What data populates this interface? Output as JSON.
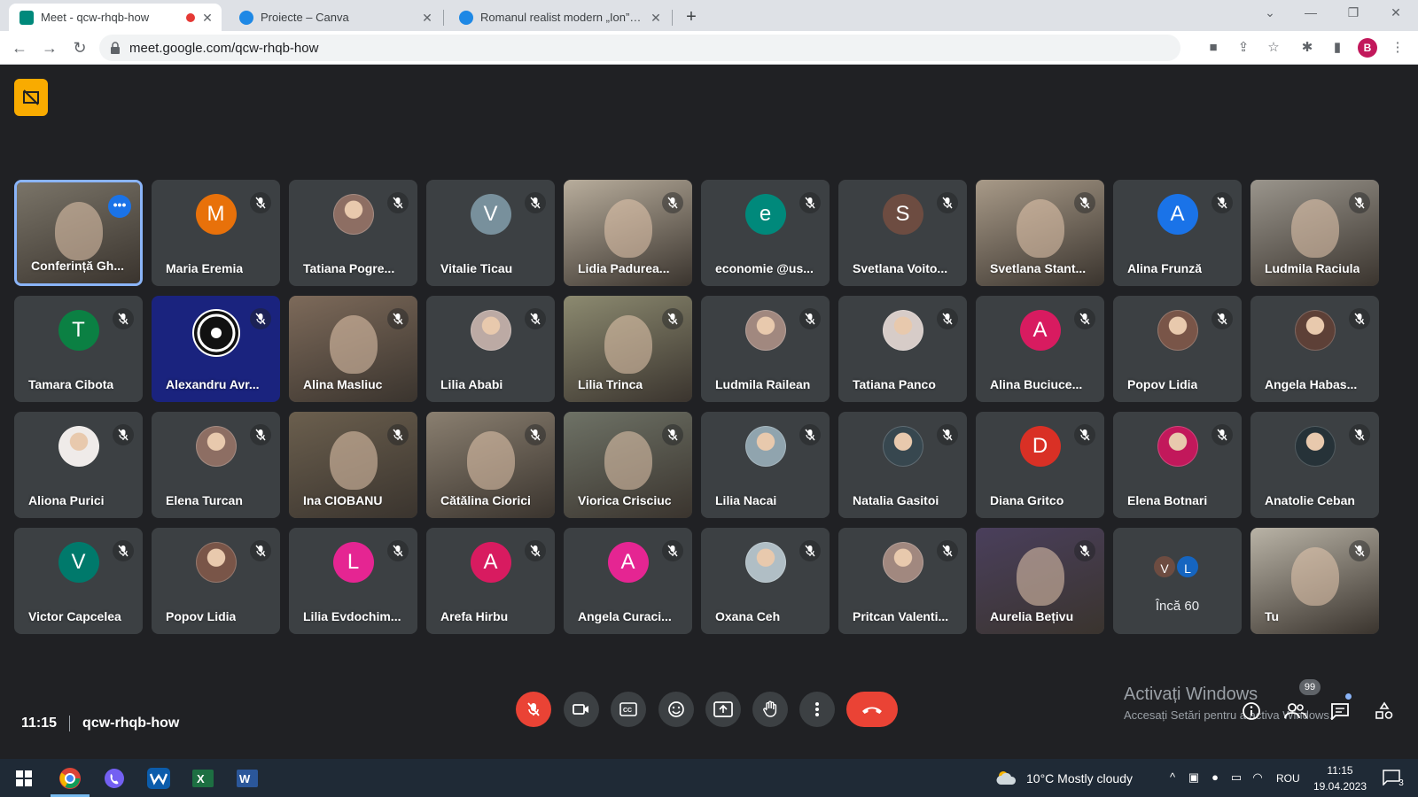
{
  "browser": {
    "tabs": [
      {
        "title": "Meet - qcw-rhqb-how",
        "favicon_color": "#00897b",
        "recording": true,
        "active": true
      },
      {
        "title": "Proiecte – Canva",
        "favicon_color": "#1e88e5",
        "recording": false,
        "active": false
      },
      {
        "title": "Romanul realist modern „Ion” de",
        "favicon_color": "#1e88e5",
        "recording": false,
        "active": false
      }
    ],
    "url": "meet.google.com/qcw-rhqb-how",
    "profile_initial": "B"
  },
  "meeting": {
    "time": "11:15",
    "code": "qcw-rhqb-how",
    "overflow": {
      "label": "Încă 60",
      "initials": [
        "V",
        "L"
      ],
      "colors": [
        "#6d4c41",
        "#1565c0"
      ]
    },
    "people_badge": "99"
  },
  "participants": [
    {
      "name": "Conferință Gh...",
      "kind": "video",
      "bg": "#7a7468",
      "selected": true
    },
    {
      "name": "Maria Eremia",
      "kind": "initial",
      "initial": "M",
      "color": "#e8710a"
    },
    {
      "name": "Tatiana Pogre...",
      "kind": "photo",
      "color": "#8d6e63"
    },
    {
      "name": "Vitalie Ticau",
      "kind": "initial",
      "initial": "V",
      "color": "#78909c"
    },
    {
      "name": "Lidia Padurea...",
      "kind": "video",
      "bg": "#b8ad9c"
    },
    {
      "name": "economie @us...",
      "kind": "initial",
      "initial": "e",
      "color": "#00897b"
    },
    {
      "name": "Svetlana Voito...",
      "kind": "initial",
      "initial": "S",
      "color": "#6d4c41"
    },
    {
      "name": "Svetlana Stant...",
      "kind": "video",
      "bg": "#a89a88"
    },
    {
      "name": "Alina Frunză",
      "kind": "initial",
      "initial": "A",
      "color": "#1a73e8"
    },
    {
      "name": "Ludmila Raciula",
      "kind": "video",
      "bg": "#9a958c"
    },
    {
      "name": "Tamara Cibota",
      "kind": "initial",
      "initial": "T",
      "color": "#0b8043"
    },
    {
      "name": "Alexandru Avr...",
      "kind": "logo",
      "bg": "#1a237e"
    },
    {
      "name": "Alina Masliuc",
      "kind": "video",
      "bg": "#7d6a5a"
    },
    {
      "name": "Lilia Ababi",
      "kind": "photo",
      "color": "#bcaaa4"
    },
    {
      "name": "Lilia Trinca",
      "kind": "video",
      "bg": "#8c8a70"
    },
    {
      "name": "Ludmila Railean",
      "kind": "photo",
      "color": "#a1887f"
    },
    {
      "name": "Tatiana Panco",
      "kind": "photo",
      "color": "#d7ccc8"
    },
    {
      "name": "Alina Buciuce...",
      "kind": "initial",
      "initial": "A",
      "color": "#d81b60"
    },
    {
      "name": "Popov Lidia",
      "kind": "photo",
      "color": "#795548"
    },
    {
      "name": "Angela Habas...",
      "kind": "photo",
      "color": "#5d4037"
    },
    {
      "name": "Aliona Purici",
      "kind": "photo",
      "color": "#efebe9"
    },
    {
      "name": "Elena Turcan",
      "kind": "photo",
      "color": "#8d6e63"
    },
    {
      "name": "Ina CIOBANU",
      "kind": "video",
      "bg": "#6b5f4e"
    },
    {
      "name": "Cătălina Ciorici",
      "kind": "video",
      "bg": "#8a7f70"
    },
    {
      "name": "Viorica Crisciuc",
      "kind": "video",
      "bg": "#6e7266"
    },
    {
      "name": "Lilia Nacai",
      "kind": "photo",
      "color": "#90a4ae"
    },
    {
      "name": "Natalia Gasitoi",
      "kind": "photo",
      "color": "#37474f"
    },
    {
      "name": "Diana Gritco",
      "kind": "initial",
      "initial": "D",
      "color": "#d93025"
    },
    {
      "name": "Elena Botnari",
      "kind": "photo",
      "color": "#c2185b"
    },
    {
      "name": "Anatolie Ceban",
      "kind": "photo",
      "color": "#263238"
    },
    {
      "name": "Victor Capcelea",
      "kind": "initial",
      "initial": "V",
      "color": "#00796b"
    },
    {
      "name": "Popov Lidia",
      "kind": "photo",
      "color": "#795548"
    },
    {
      "name": "Lilia Evdochim...",
      "kind": "initial",
      "initial": "L",
      "color": "#e52592"
    },
    {
      "name": "Arefa Hirbu",
      "kind": "initial",
      "initial": "A",
      "color": "#d81b60"
    },
    {
      "name": "Angela Curaci...",
      "kind": "initial",
      "initial": "A",
      "color": "#e52592"
    },
    {
      "name": "Oxana Ceh",
      "kind": "photo",
      "color": "#b0bec5"
    },
    {
      "name": "Pritcan Valenti...",
      "kind": "photo",
      "color": "#a1887f"
    },
    {
      "name": "Aurelia Bețivu",
      "kind": "video",
      "bg": "#4a3f5c"
    },
    {
      "name": "",
      "kind": "more"
    },
    {
      "name": "Tu",
      "kind": "video",
      "bg": "#b9b3a6"
    }
  ],
  "windows_notice": {
    "title": "Activați Windows",
    "subtitle": "Accesați Setări pentru a activa Windows."
  },
  "taskbar": {
    "weather": "10°C  Mostly cloudy",
    "language": "ROU",
    "time": "11:15",
    "date": "19.04.2023",
    "notification_count": "3"
  }
}
